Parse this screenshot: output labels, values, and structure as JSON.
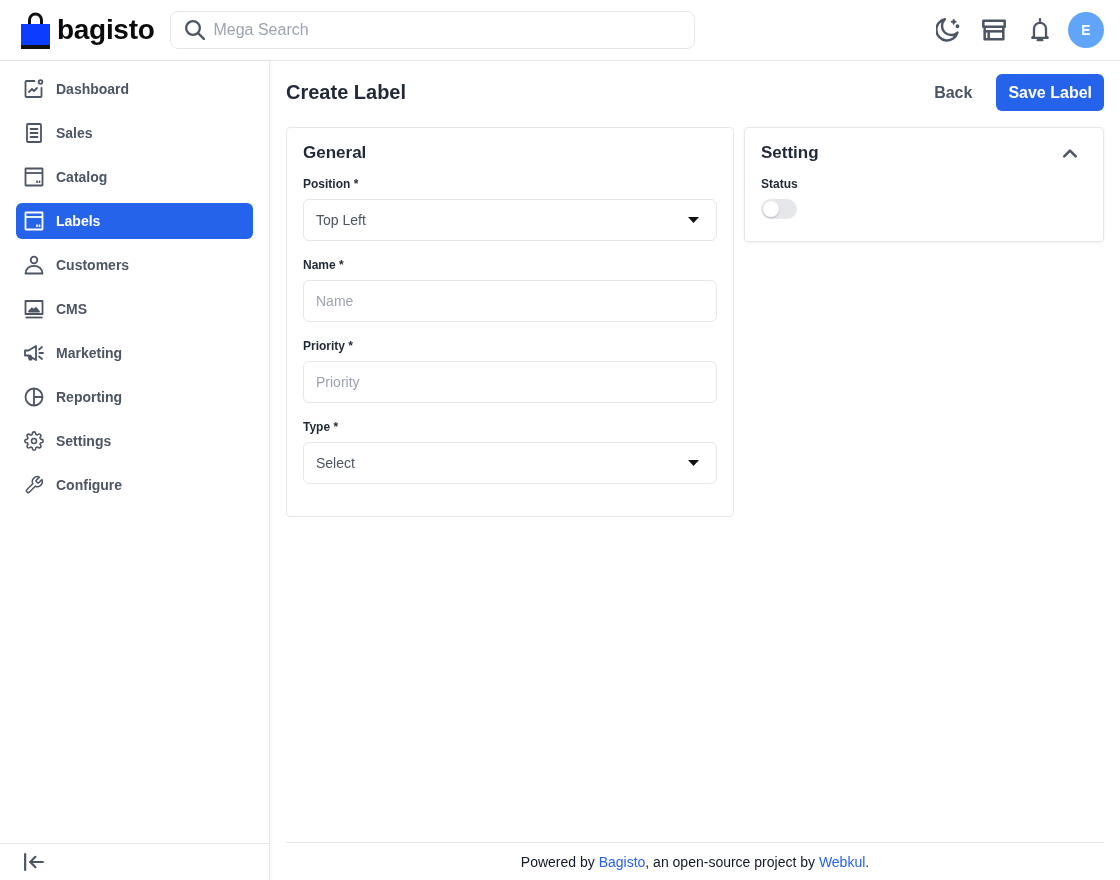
{
  "header": {
    "logo": "bagisto",
    "search": {
      "placeholder": "Mega Search"
    },
    "avatar": "E"
  },
  "sidebar": {
    "items": [
      {
        "label": "Dashboard",
        "selected": false
      },
      {
        "label": "Sales",
        "selected": false
      },
      {
        "label": "Catalog",
        "selected": false
      },
      {
        "label": "Labels",
        "selected": true
      },
      {
        "label": "Customers",
        "selected": false
      },
      {
        "label": "CMS",
        "selected": false
      },
      {
        "label": "Marketing",
        "selected": false
      },
      {
        "label": "Reporting",
        "selected": false
      },
      {
        "label": "Settings",
        "selected": false
      },
      {
        "label": "Configure",
        "selected": false
      }
    ]
  },
  "page": {
    "title": "Create Label",
    "back_button": "Back",
    "save_button": "Save Label"
  },
  "general": {
    "title": "General",
    "fields": [
      {
        "kind": "select",
        "label": "Position *",
        "value": "Top Left"
      },
      {
        "kind": "input",
        "label": "Name *",
        "placeholder": "Name"
      },
      {
        "kind": "input",
        "label": "Priority *",
        "placeholder": "Priority"
      },
      {
        "kind": "select",
        "label": "Type *",
        "value": "Select"
      }
    ]
  },
  "setting": {
    "title": "Setting",
    "expanded": true,
    "status": {
      "label": "Status",
      "on": false
    }
  },
  "footer": {
    "parts": [
      {
        "kind": "text",
        "text": "Powered by "
      },
      {
        "kind": "link",
        "text": "Bagisto"
      },
      {
        "kind": "text",
        "text": ", an open-source project by "
      },
      {
        "kind": "link",
        "text": "Webkul"
      },
      {
        "kind": "text",
        "text": "."
      }
    ]
  }
}
